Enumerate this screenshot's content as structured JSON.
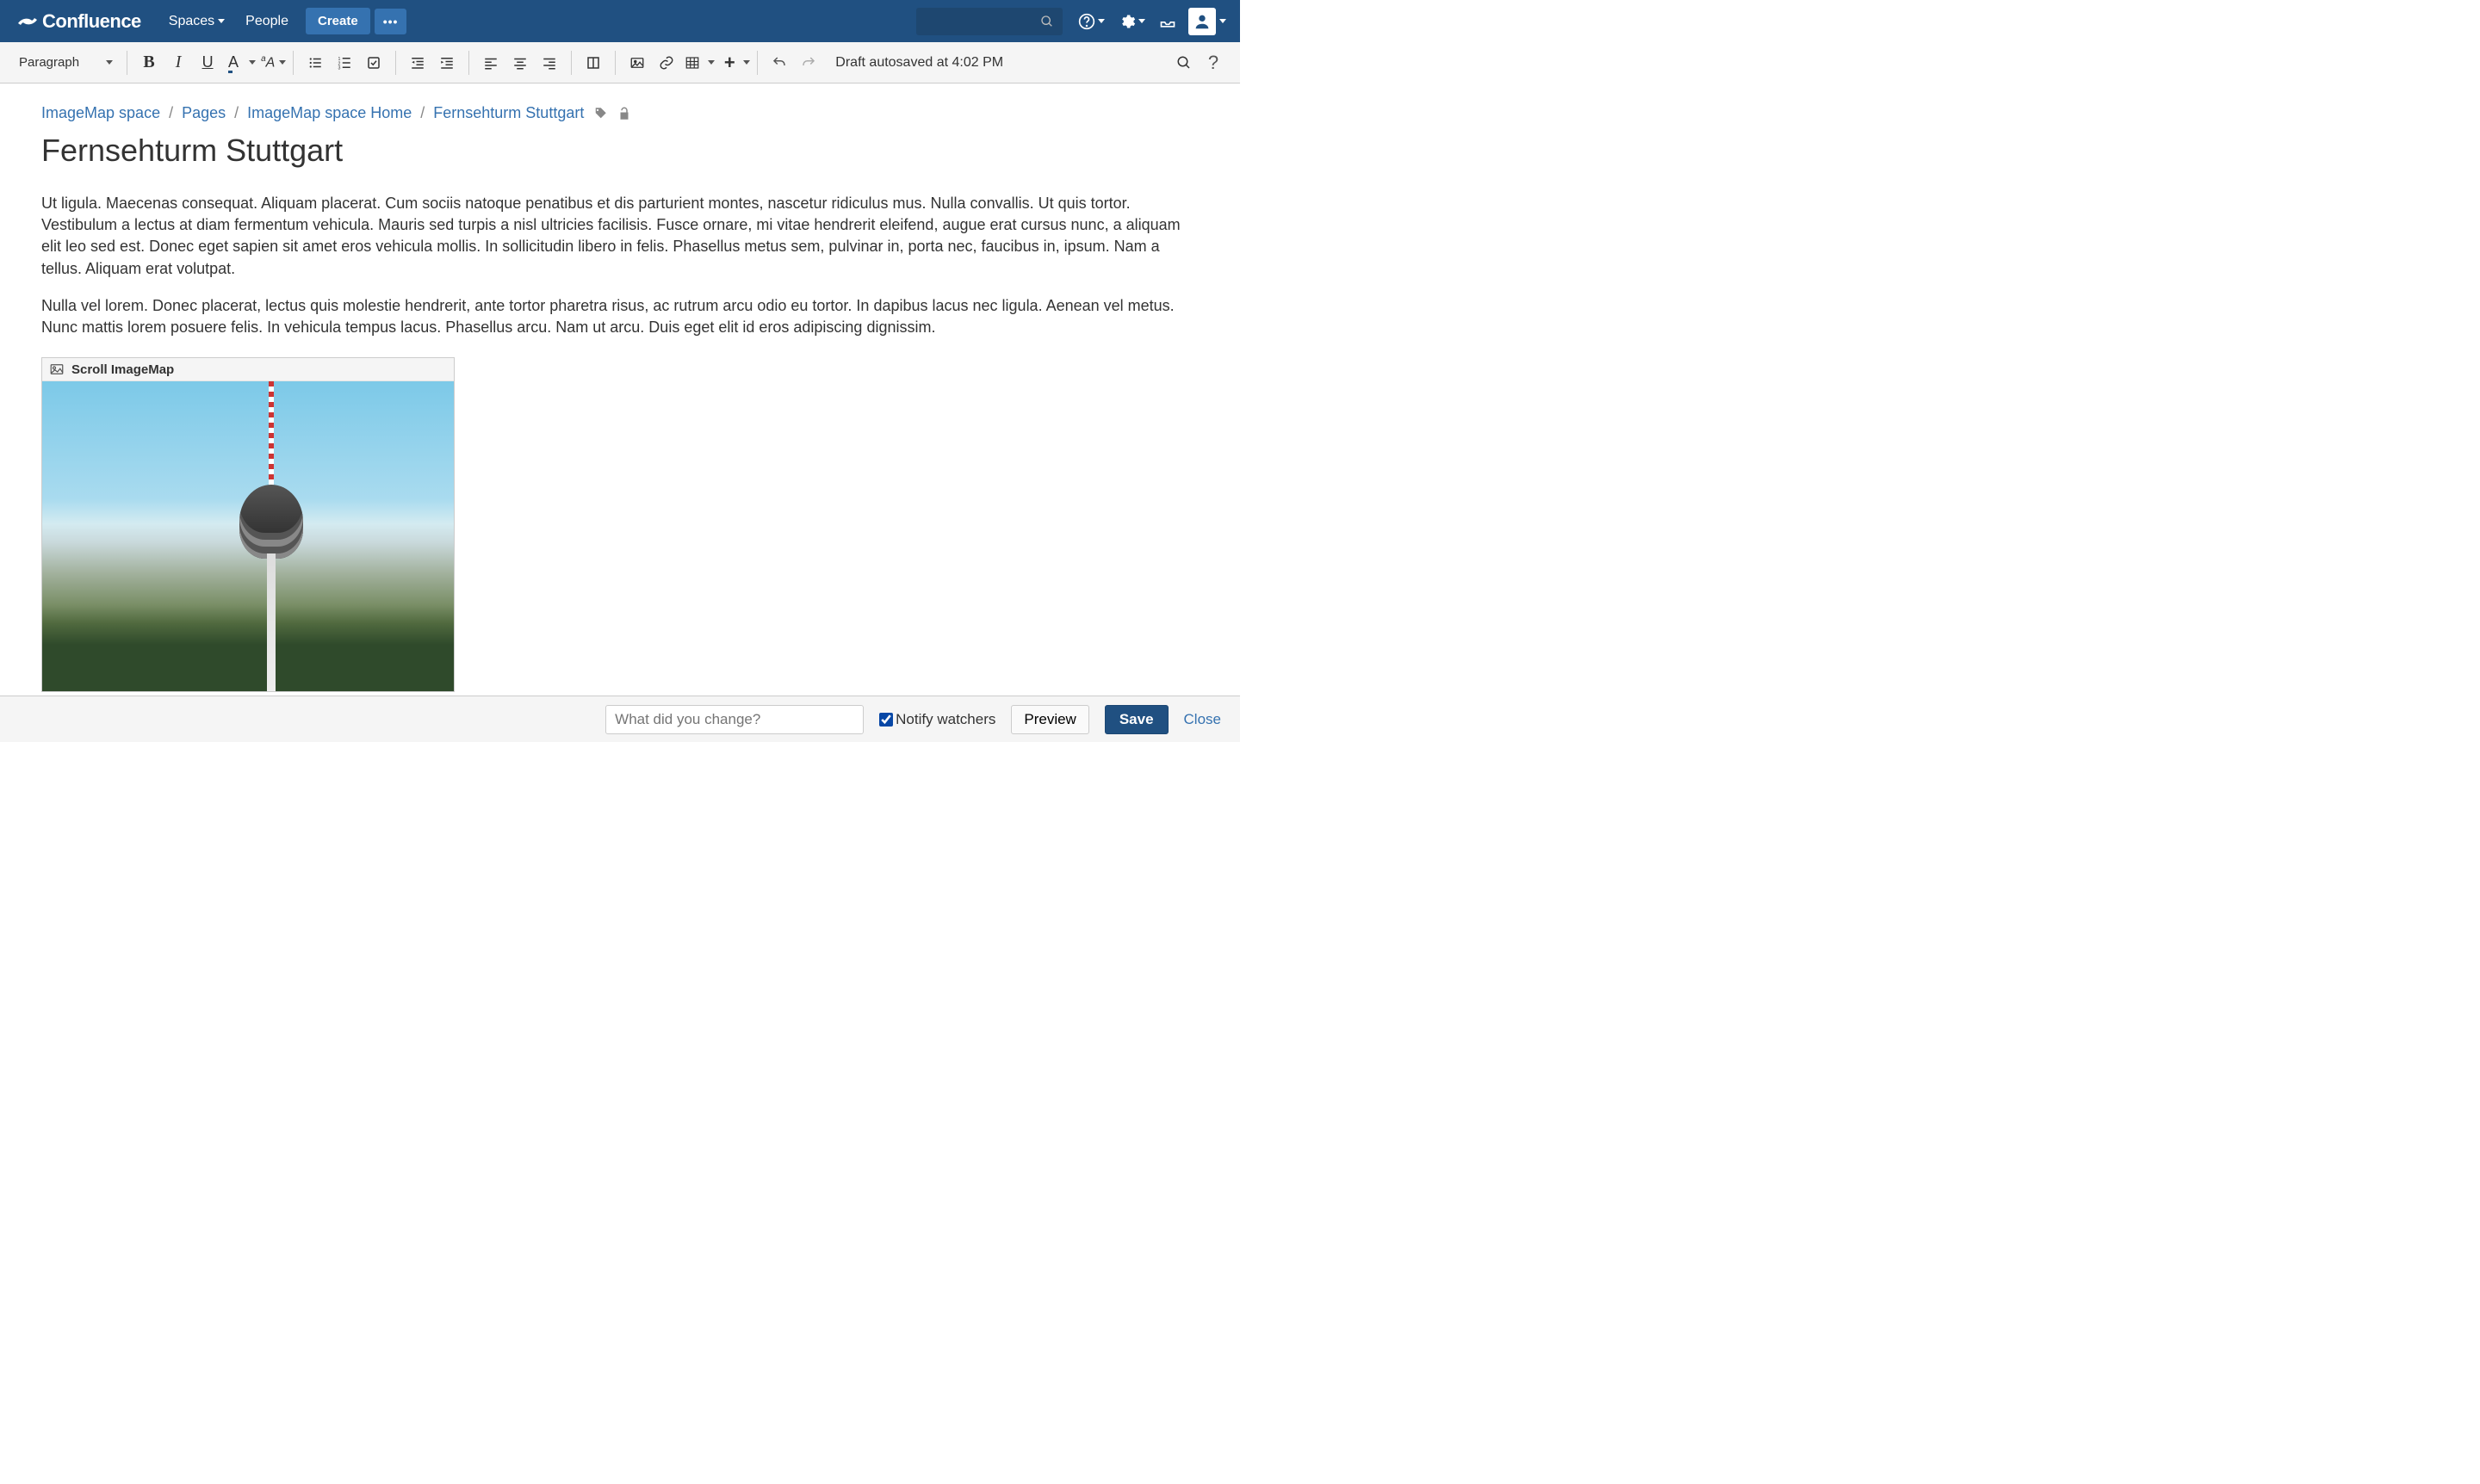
{
  "navbar": {
    "brand": "Confluence",
    "links": {
      "spaces": "Spaces",
      "people": "People"
    },
    "create": "Create"
  },
  "toolbar": {
    "style_label": "Paragraph",
    "autosave": "Draft autosaved at 4:02 PM"
  },
  "breadcrumbs": {
    "space": "ImageMap space",
    "pages": "Pages",
    "home": "ImageMap space Home",
    "current": "Fernsehturm Stuttgart"
  },
  "page": {
    "title": "Fernsehturm Stuttgart",
    "p1": "Ut ligula. Maecenas consequat. Aliquam placerat. Cum sociis natoque penatibus et dis parturient montes, nascetur ridiculus mus. Nulla convallis. Ut quis tortor. Vestibulum a lectus at diam fermentum vehicula. Mauris sed turpis a nisl ultricies facilisis. Fusce ornare, mi vitae hendrerit eleifend, augue erat cursus nunc, a aliquam elit leo sed est. Donec eget sapien sit amet eros vehicula mollis. In sollicitudin libero in felis. Phasellus metus sem, pulvinar in, porta nec, faucibus in, ipsum. Nam a tellus. Aliquam erat volutpat.",
    "p2": "Nulla vel lorem. Donec placerat, lectus quis molestie hendrerit, ante tortor pharetra risus, ac rutrum arcu odio eu tortor. In dapibus lacus nec ligula. Aenean vel metus. Nunc mattis lorem posuere felis. In vehicula tempus lacus. Phasellus arcu. Nam ut arcu. Duis eget elit id eros adipiscing dignissim."
  },
  "macro": {
    "label": "Scroll ImageMap"
  },
  "footer": {
    "placeholder": "What did you change?",
    "notify": "Notify watchers",
    "preview": "Preview",
    "save": "Save",
    "close": "Close"
  }
}
